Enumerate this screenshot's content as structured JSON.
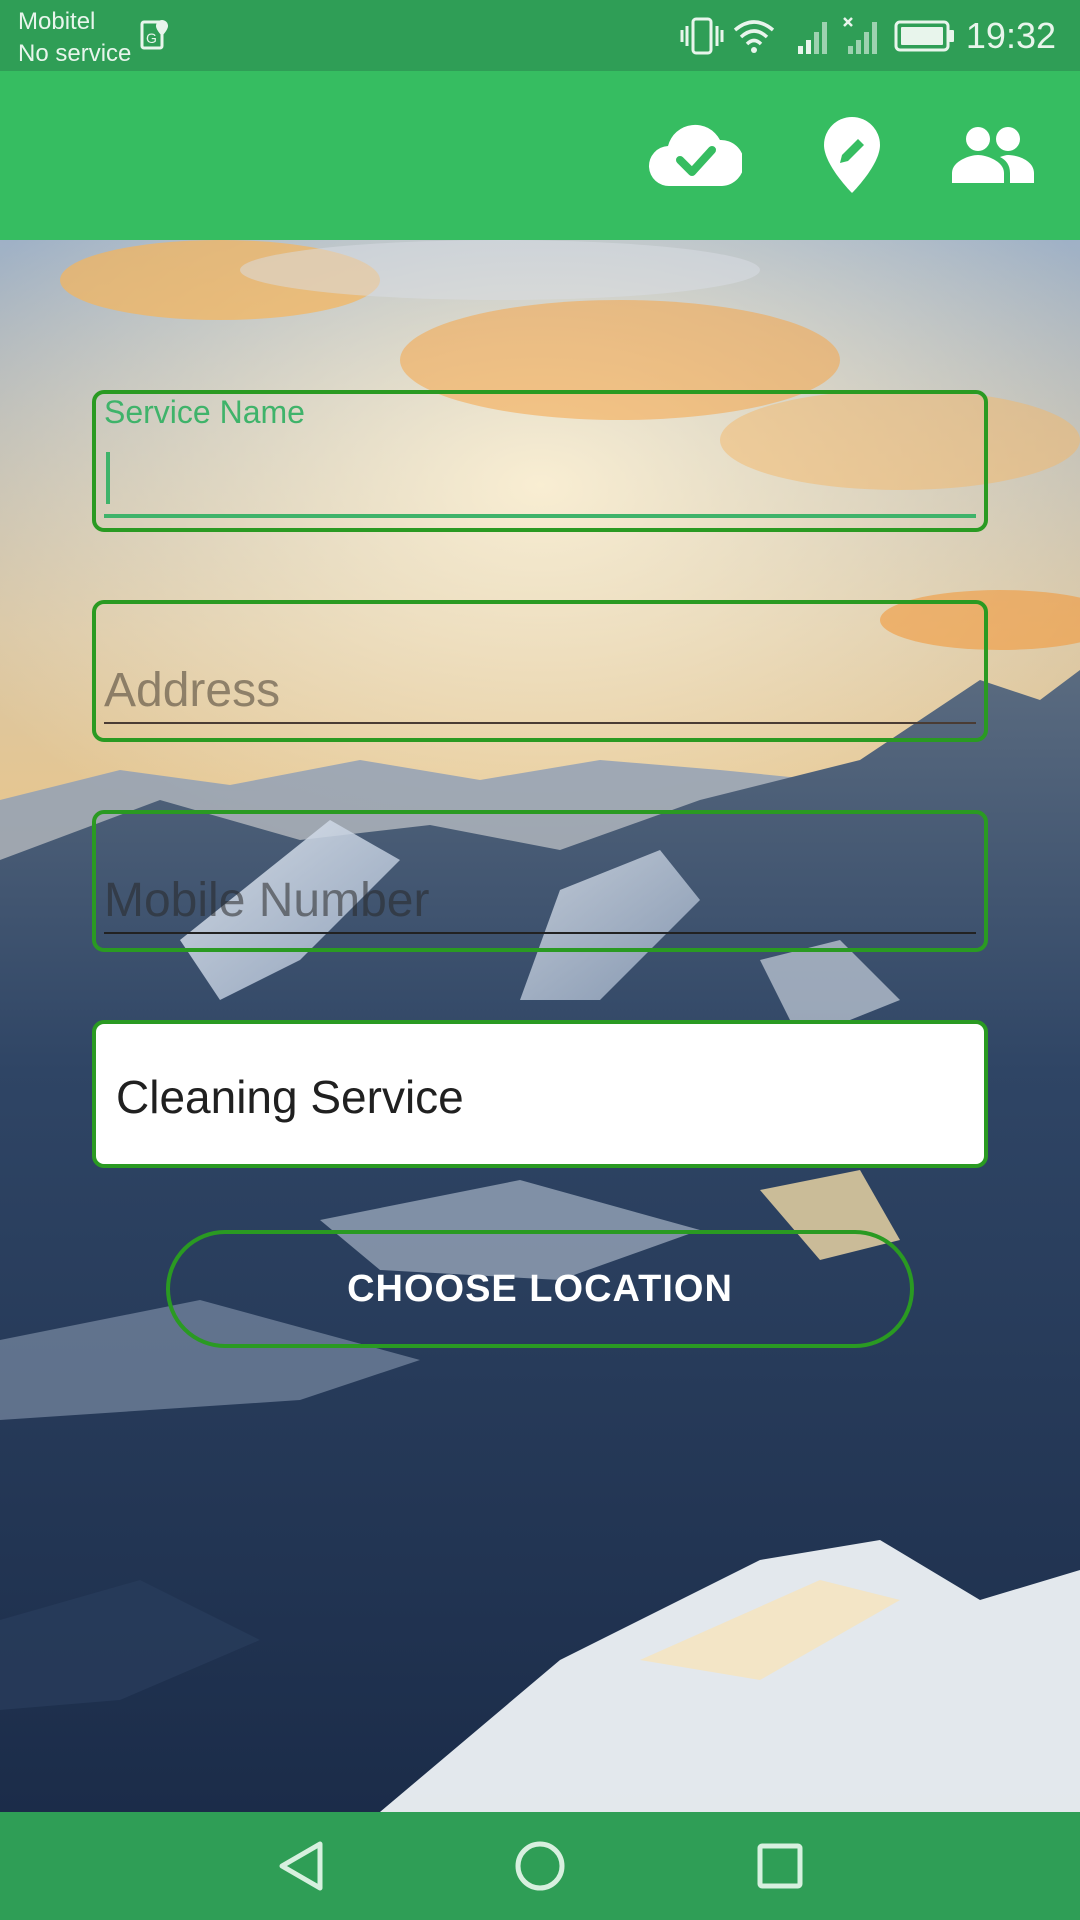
{
  "status_bar": {
    "carrier": "Mobitel",
    "service": "No service",
    "time": "19:32",
    "icons": [
      "location-sim-icon",
      "vibrate-icon",
      "wifi-icon",
      "signal-icon",
      "signal-no-sim-icon",
      "battery-icon"
    ]
  },
  "app_bar": {
    "actions": [
      "cloud-done-icon",
      "edit-location-icon",
      "people-icon"
    ],
    "color": "#36bd61"
  },
  "form": {
    "service_name": {
      "label": "Service Name",
      "value": ""
    },
    "address": {
      "placeholder": "Address",
      "value": ""
    },
    "mobile": {
      "placeholder": "Mobile Number",
      "value": ""
    },
    "service_type": {
      "selected": "Cleaning Service"
    },
    "choose_location_label": "CHOOSE LOCATION"
  },
  "nav_bar": {
    "buttons": [
      "back-icon",
      "home-icon",
      "recents-icon"
    ]
  },
  "colors": {
    "accent": "#3fb36a",
    "field_border": "#2a9a22",
    "bars": "#2f9e56"
  }
}
